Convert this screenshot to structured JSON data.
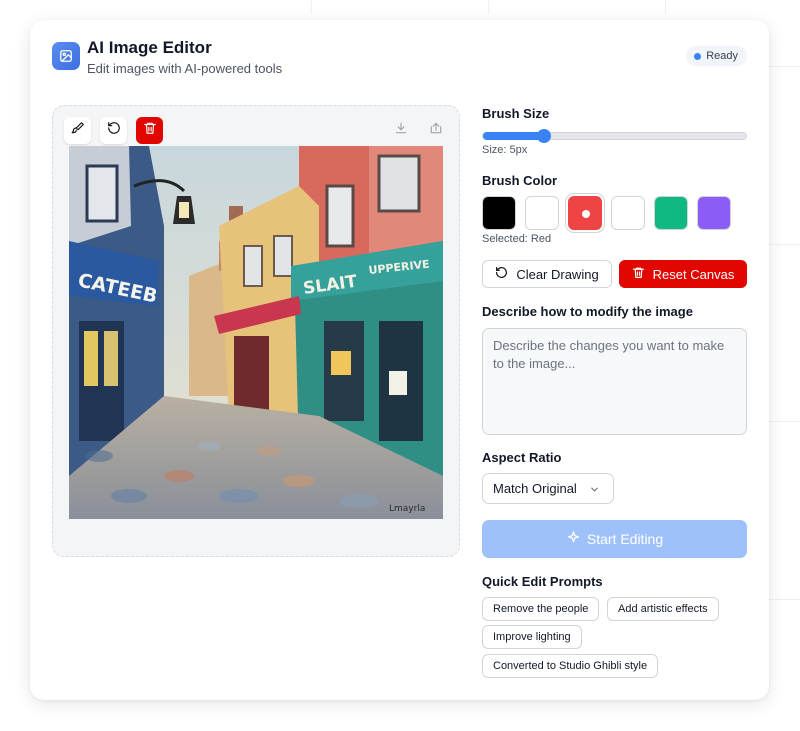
{
  "header": {
    "title": "AI Image Editor",
    "subtitle": "Edit images with AI-powered tools",
    "status": "Ready",
    "icon": "image-icon"
  },
  "canvas": {
    "tools": [
      "brush-icon",
      "undo-icon",
      "trash-icon",
      "download-icon",
      "upload-icon"
    ]
  },
  "brush": {
    "label": "Brush Size",
    "value_text": "Size: 5px",
    "slider_fraction": 0.23
  },
  "color": {
    "label": "Brush Color",
    "swatches": [
      "#000000",
      "#ffffff",
      "#ef4444",
      "#ffffff",
      "#10b981",
      "#8b5cf6"
    ],
    "selected_index": 2,
    "selected_text": "Selected: Red"
  },
  "actions": {
    "clear_label": "Clear Drawing",
    "reset_label": "Reset Canvas"
  },
  "prompt": {
    "label": "Describe how to modify the image",
    "placeholder": "Describe the changes you want to make to the image..."
  },
  "aspect": {
    "label": "Aspect Ratio",
    "selected": "Match Original"
  },
  "start": {
    "label": "Start Editing"
  },
  "quick": {
    "label": "Quick Edit Prompts",
    "chips": [
      "Remove the people",
      "Add artistic effects",
      "Improve lighting",
      "Converted to Studio Ghibli style"
    ]
  },
  "colors": {
    "accent": "#3b82f6",
    "danger": "#e10600",
    "disabled_primary": "#9fc1fb"
  }
}
